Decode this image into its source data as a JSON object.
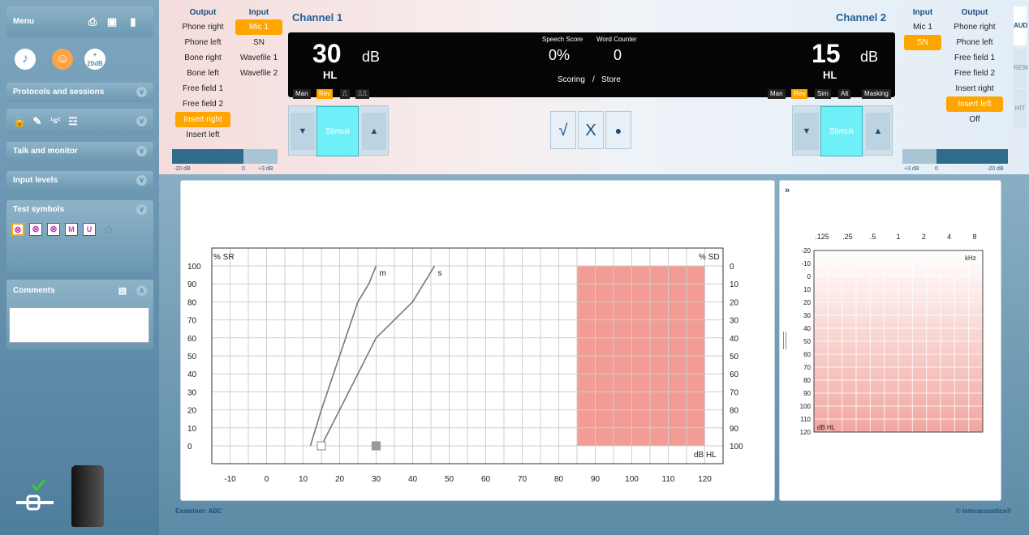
{
  "sidebar": {
    "menu_label": "Menu",
    "sections": {
      "protocols": "Protocols and sessions",
      "talk": "Talk and monitor",
      "input_levels": "Input levels",
      "test_symbols": "Test symbols",
      "comments": "Comments"
    },
    "add20db_label": "20dB"
  },
  "channel1": {
    "title": "Channel 1",
    "output_header": "Output",
    "input_header": "Input",
    "outputs": [
      "Phone right",
      "Phone left",
      "Bone right",
      "Bone left",
      "Free field 1",
      "Free field 2",
      "Insert right",
      "Insert left"
    ],
    "output_selected": 6,
    "inputs": [
      "Mic 1",
      "SN",
      "Wavefile 1",
      "Wavefile 2"
    ],
    "input_selected": 0,
    "level": "30",
    "unit": "dB",
    "scale": "HL",
    "modes": [
      "Man",
      "Rev",
      "⎍",
      "⎍⎍"
    ],
    "mode_selected": 1,
    "stimuli": "Stimuli",
    "slider_min": "-20 dB",
    "slider_zero": "0",
    "slider_max": "+3 dB"
  },
  "channel2": {
    "title": "Channel 2",
    "output_header": "Output",
    "input_header": "Input",
    "outputs": [
      "Phone right",
      "Phone left",
      "Free field 1",
      "Free field 2",
      "Insert right",
      "Insert left",
      "Off"
    ],
    "output_selected": 5,
    "inputs": [
      "Mic 1",
      "SN"
    ],
    "input_selected": 1,
    "level": "15",
    "unit": "dB",
    "scale": "HL",
    "modes": [
      "Man",
      "Rev",
      "Sim",
      "Alt",
      "Masking"
    ],
    "mode_selected": 1,
    "stimuli": "Stimuli",
    "slider_min": "-20 dB",
    "slider_zero": "0",
    "slider_max": "+3 dB"
  },
  "center": {
    "speech_score_label": "Speech Score",
    "word_counter_label": "Word Counter",
    "speech_score": "0%",
    "word_counter": "0",
    "scoring_label": "Scoring",
    "store_label": "Store",
    "sep": "/",
    "correct": "√",
    "incorrect": "X",
    "dot": "●"
  },
  "speech_graph": {
    "left_label": "% SR",
    "right_label": "% SD",
    "bottom_right": "dB HL",
    "y_left": [
      "100",
      "90",
      "80",
      "70",
      "60",
      "50",
      "40",
      "30",
      "20",
      "10",
      "0"
    ],
    "y_right": [
      "0",
      "10",
      "20",
      "30",
      "40",
      "50",
      "60",
      "70",
      "80",
      "90",
      "100"
    ],
    "x_ticks": [
      "-10",
      "0",
      "10",
      "20",
      "30",
      "40",
      "50",
      "60",
      "70",
      "80",
      "90",
      "100",
      "110",
      "120"
    ],
    "curve_m_label": "m",
    "curve_s_label": "s"
  },
  "chart_data": {
    "type": "line",
    "xlabel": "dB HL",
    "ylabel": "% SR",
    "xlim": [
      -10,
      120
    ],
    "ylim": [
      0,
      100
    ],
    "series": [
      {
        "name": "m",
        "x": [
          12,
          15,
          20,
          25,
          28,
          30
        ],
        "y": [
          0,
          20,
          50,
          80,
          90,
          100
        ]
      },
      {
        "name": "s",
        "x": [
          15,
          20,
          25,
          30,
          35,
          40,
          46
        ],
        "y": [
          0,
          20,
          40,
          60,
          70,
          80,
          100
        ]
      }
    ],
    "shaded_region": {
      "x": [
        85,
        120
      ],
      "y": [
        0,
        100
      ],
      "color": "#f29c95"
    },
    "markers": [
      {
        "x": 15,
        "y": 0,
        "style": "open-square"
      },
      {
        "x": 30,
        "y": 0,
        "style": "filled-square"
      }
    ]
  },
  "audiogram": {
    "freqs": [
      ".125",
      ".25",
      ".5",
      "1",
      "2",
      "4",
      "8"
    ],
    "khz": "kHz",
    "levels": [
      "-20",
      "-10",
      "0",
      "10",
      "20",
      "30",
      "40",
      "50",
      "60",
      "70",
      "80",
      "90",
      "100",
      "110",
      "120"
    ],
    "unit": "dB HL",
    "expand": "»"
  },
  "footer": {
    "examiner": "Examiner: ABC",
    "brand": "© Interacoustics®"
  },
  "tabs": [
    "AUD",
    "REM",
    "HIT"
  ]
}
